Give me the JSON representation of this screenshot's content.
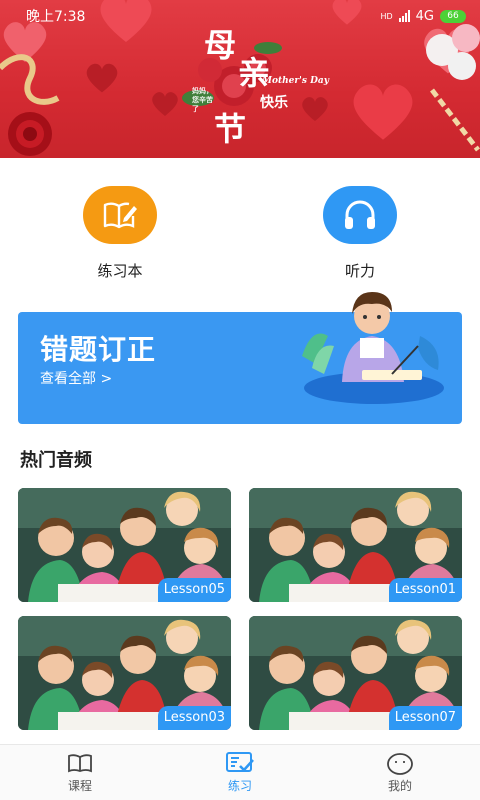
{
  "status": {
    "time": "晚上7:38",
    "network": "4G",
    "hd": "HD",
    "battery": "66"
  },
  "banner": {
    "title_char_1": "母",
    "title_char_2": "亲",
    "title_char_3": "节",
    "subtitle": "快乐",
    "english": "Mother's Day",
    "small_text": "妈妈，您辛苦了"
  },
  "quick_actions": [
    {
      "label": "练习本",
      "icon": "notebook-pencil-icon",
      "color": "#f59a12"
    },
    {
      "label": "听力",
      "icon": "headphones-icon",
      "color": "#2f98f4"
    }
  ],
  "correction_card": {
    "title": "错题订正",
    "link": "查看全部 >"
  },
  "hot_audio": {
    "title": "热门音频",
    "items": [
      {
        "lesson": "Lesson05"
      },
      {
        "lesson": "Lesson01"
      },
      {
        "lesson": "Lesson03"
      },
      {
        "lesson": "Lesson07"
      }
    ]
  },
  "tabs": [
    {
      "label": "课程",
      "icon": "book-icon",
      "active": false
    },
    {
      "label": "练习",
      "icon": "checklist-icon",
      "active": true
    },
    {
      "label": "我的",
      "icon": "face-icon",
      "active": false
    }
  ],
  "colors": {
    "banner_red": "#d42a32",
    "accent_blue": "#2f98f4",
    "accent_orange": "#f59a12"
  }
}
